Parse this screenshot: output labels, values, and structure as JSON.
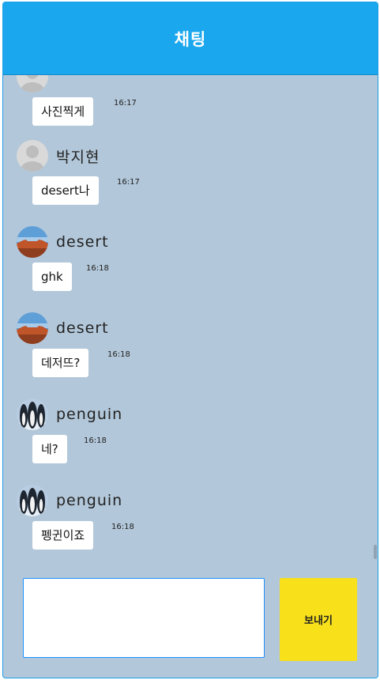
{
  "header": {
    "title": "채팅"
  },
  "messages": [
    {
      "sender": "",
      "text": "사진찍게",
      "time": "16:17",
      "avatar": "default-profile"
    },
    {
      "sender": "박지현",
      "text": "desert나",
      "time": "16:17",
      "avatar": "default-profile"
    },
    {
      "sender": "desert",
      "text": "ghk",
      "time": "16:18",
      "avatar": "desert-photo"
    },
    {
      "sender": "desert",
      "text": "데저뜨?",
      "time": "16:18",
      "avatar": "desert-photo"
    },
    {
      "sender": "penguin",
      "text": "네?",
      "time": "16:18",
      "avatar": "penguin-photo"
    },
    {
      "sender": "penguin",
      "text": "펭귄이죠",
      "time": "16:18",
      "avatar": "penguin-photo"
    }
  ],
  "composer": {
    "input_value": "",
    "send_label": "보내기"
  },
  "colors": {
    "header": "#1aa7ee",
    "background": "#b2c7d9",
    "bubble": "#ffffff",
    "send_button": "#f8e01a"
  }
}
